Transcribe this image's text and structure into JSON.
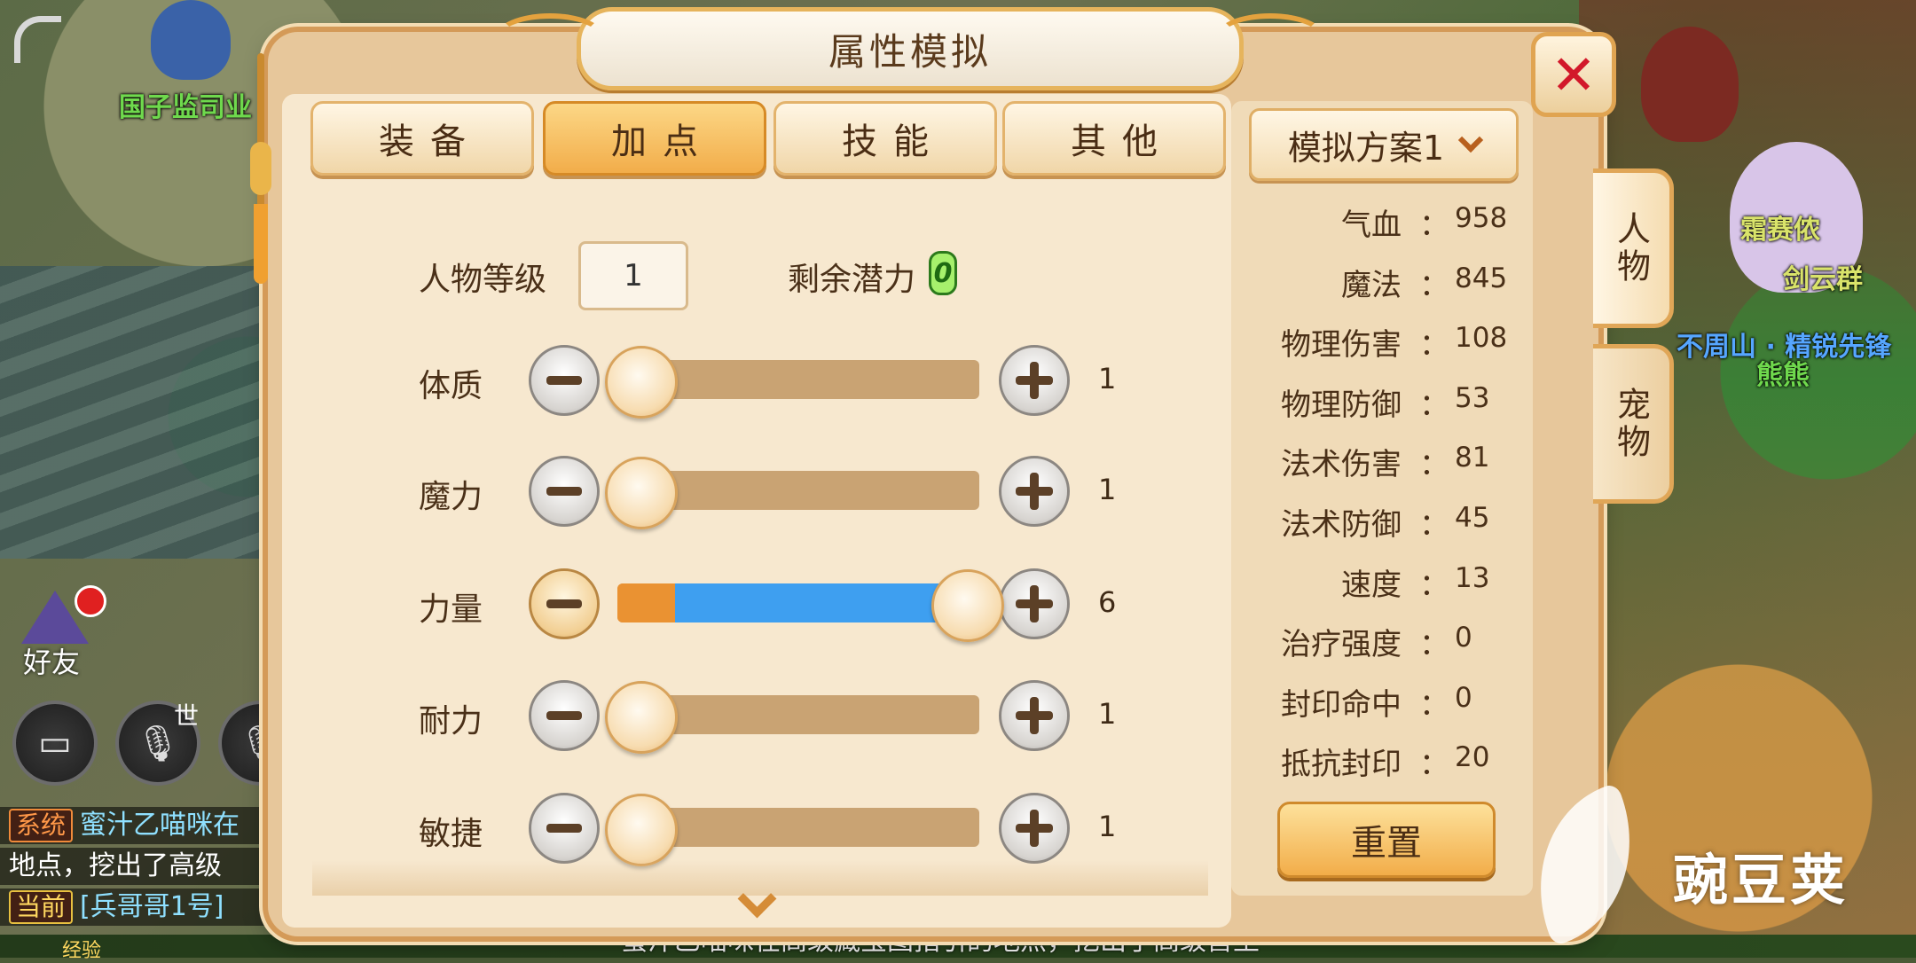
{
  "scene": {
    "npc_labels": [
      {
        "text": "国子监司业",
        "style": "green"
      },
      {
        "text": "不周山 · 精锐先锋",
        "style": "blue"
      },
      {
        "text": "熊熊",
        "style": "green"
      },
      {
        "text": "霜赛侬",
        "style": "yel"
      },
      {
        "text": "剑云群",
        "style": "yel"
      }
    ],
    "friend_label": "好友",
    "voice_world": "世",
    "chat_lines": [
      {
        "tag": "系统",
        "text": "蜜汁乙喵咪在"
      },
      {
        "tag": "",
        "text": "地点，挖出了高级"
      },
      {
        "tag": "当前",
        "text": "[兵哥哥1号]"
      }
    ],
    "bottom_label": "经验",
    "bottom_text": "蜜汁乙喵咪在高级藏宝图指引的地点，挖出了高级兽王"
  },
  "panel": {
    "title": "属性模拟",
    "close_icon": "close-icon",
    "tabs": [
      {
        "label": "装备",
        "active": false
      },
      {
        "label": "加点",
        "active": true
      },
      {
        "label": "技能",
        "active": false
      },
      {
        "label": "其他",
        "active": false
      }
    ],
    "level": {
      "label": "人物等级",
      "value": "1"
    },
    "potential": {
      "label": "剩余潜力",
      "value": "0"
    },
    "stats": [
      {
        "label": "体质",
        "value": "1",
        "base_fraction": 0.06,
        "knob_fraction": 0.06,
        "active": false
      },
      {
        "label": "魔力",
        "value": "1",
        "base_fraction": 0.06,
        "knob_fraction": 0.06,
        "active": false
      },
      {
        "label": "力量",
        "value": "6",
        "base_fraction": 0.16,
        "knob_fraction": 0.96,
        "active": true
      },
      {
        "label": "耐力",
        "value": "1",
        "base_fraction": 0.06,
        "knob_fraction": 0.06,
        "active": false
      },
      {
        "label": "敏捷",
        "value": "1",
        "base_fraction": 0.06,
        "knob_fraction": 0.06,
        "active": false
      }
    ],
    "plan_selector": "模拟方案1",
    "attributes": [
      {
        "name": "气血",
        "value": "958"
      },
      {
        "name": "魔法",
        "value": "845"
      },
      {
        "name": "物理伤害",
        "value": "108"
      },
      {
        "name": "物理防御",
        "value": "53"
      },
      {
        "name": "法术伤害",
        "value": "81"
      },
      {
        "name": "法术防御",
        "value": "45"
      },
      {
        "name": "速度",
        "value": "13"
      },
      {
        "name": "治疗强度",
        "value": "0"
      },
      {
        "name": "封印命中",
        "value": "0"
      },
      {
        "name": "抵抗封印",
        "value": "20"
      }
    ],
    "attr_colon": "：",
    "reset_label": "重置",
    "side_tabs": [
      {
        "label": "人物",
        "active": true
      },
      {
        "label": "宠物",
        "active": false
      }
    ]
  },
  "watermark": "豌豆荚",
  "colors": {
    "accent": "#f2ad4a",
    "slider_add": "#3e9ff0",
    "slider_base": "#ea9232",
    "close": "#d2182a"
  }
}
